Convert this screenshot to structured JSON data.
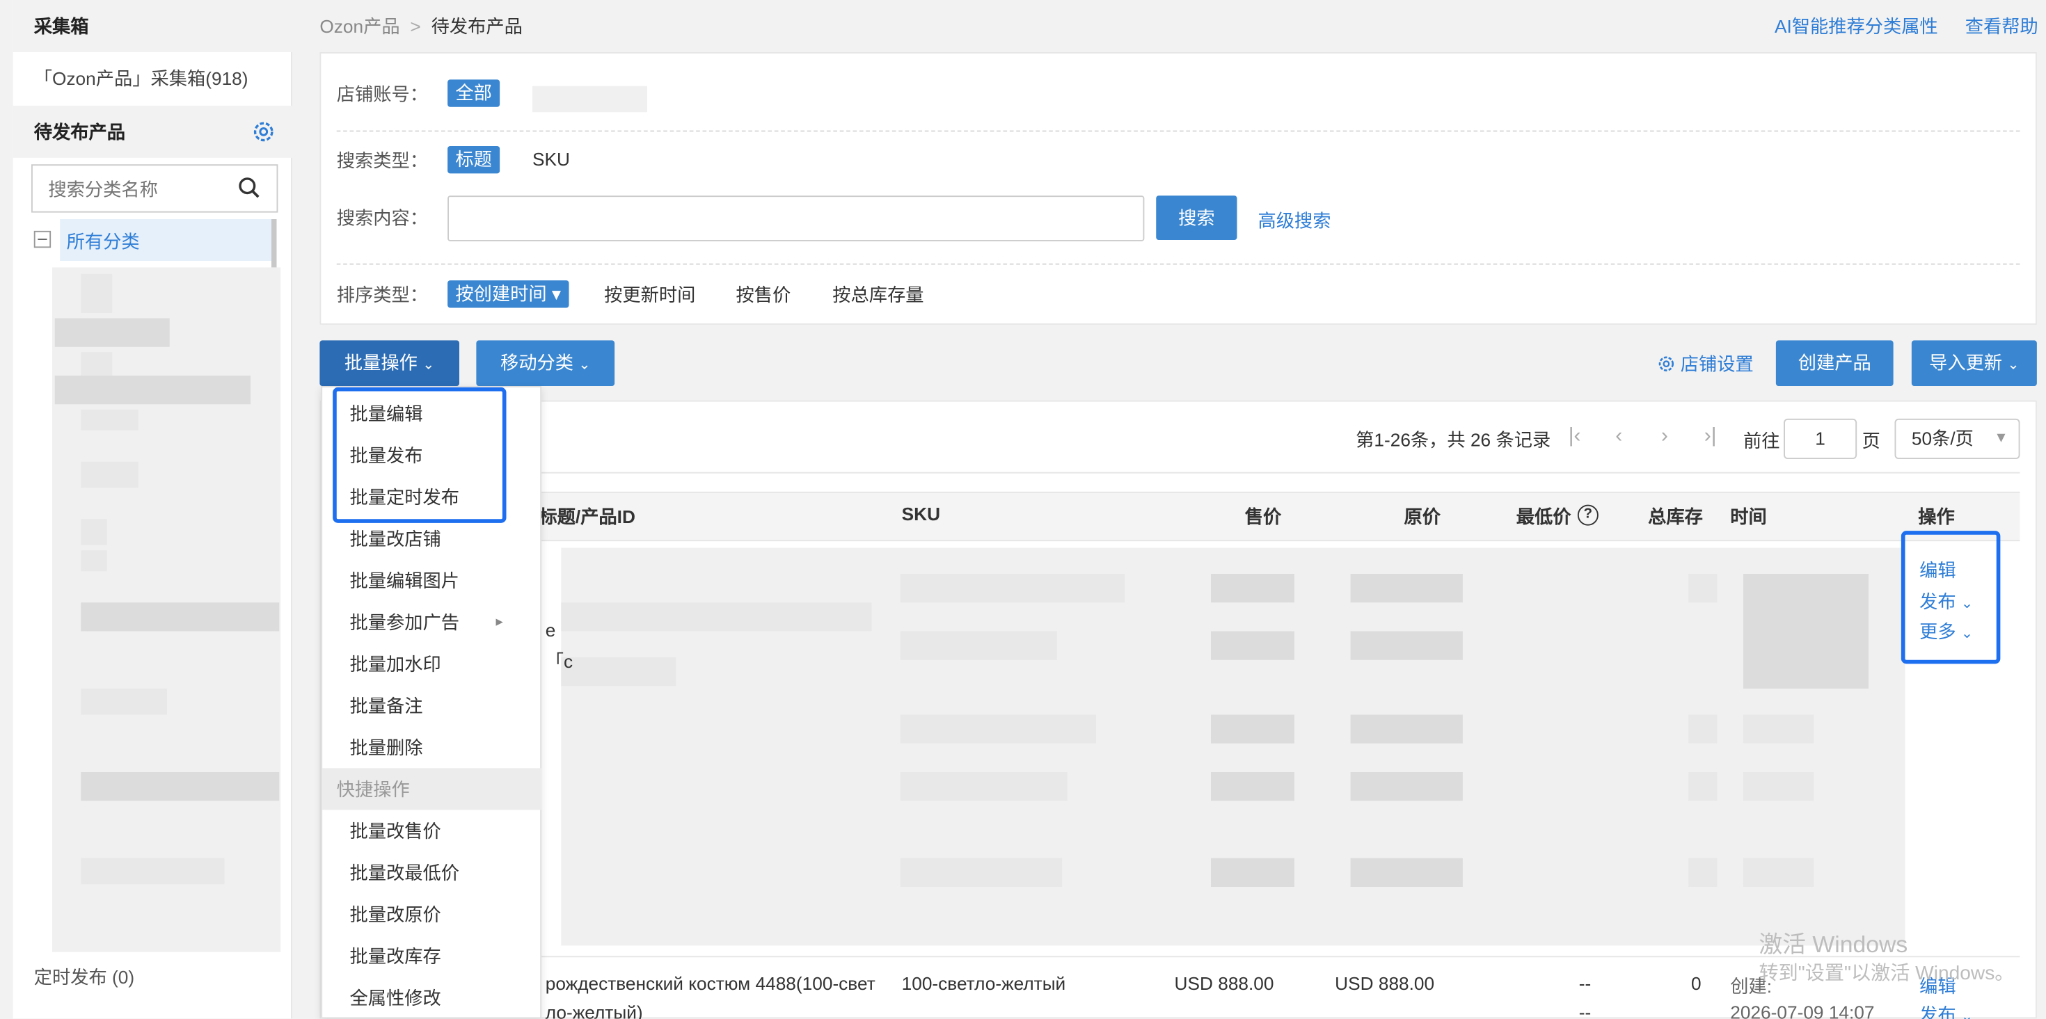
{
  "sidebar": {
    "collect_title": "采集箱",
    "collect_item": "「Ozon产品」采集箱(918)",
    "pending_title": "待发布产品",
    "search_placeholder": "搜索分类名称",
    "all_category": "所有分类",
    "scheduled": "定时发布 (0)"
  },
  "breadcrumb": {
    "root": "Ozon产品",
    "separator": ">",
    "current": "待发布产品"
  },
  "header_links": {
    "ai": "AI智能推荐分类属性",
    "help": "查看帮助"
  },
  "filters": {
    "store_label": "店铺账号：",
    "store_tag": "全部",
    "search_type_label": "搜索类型：",
    "search_type_active": "标题",
    "search_type_other": "SKU",
    "search_content_label": "搜索内容：",
    "search_value": "",
    "search_button": "搜索",
    "advanced_search": "高级搜索",
    "sort_label": "排序类型：",
    "sort_active": "按创建时间 ▾",
    "sort_options": [
      "按更新时间",
      "按售价",
      "按总库存量"
    ]
  },
  "toolbar": {
    "batch_ops": "批量操作",
    "move_category": "移动分类",
    "store_settings": "店铺设置",
    "create_product": "创建产品",
    "import_update": "导入更新"
  },
  "batch_menu": {
    "items": [
      "批量编辑",
      "批量发布",
      "批量定时发布",
      "批量改店铺",
      "批量编辑图片",
      "批量参加广告",
      "批量加水印",
      "批量备注",
      "批量删除"
    ],
    "group_label": "快捷操作",
    "quick_items": [
      "批量改售价",
      "批量改最低价",
      "批量改原价",
      "批量改库存",
      "全属性修改"
    ]
  },
  "pagination": {
    "summary": "第1-26条，共 26 条记录",
    "goto_label": "前往",
    "page_value": "1",
    "page_unit": "页",
    "page_size": "50条/页"
  },
  "table": {
    "columns": [
      "标题/产品ID",
      "SKU",
      "售价",
      "原价",
      "最低价",
      "总库存",
      "时间",
      "操作"
    ],
    "row_actions": [
      "编辑",
      "发布",
      "更多"
    ],
    "partial_title_prefix": "e",
    "partial_title_line2": "「c",
    "bottom_row": {
      "title_line1": "рождественский костюм 4488(100-свет",
      "title_line2": "ло-желтый)",
      "sku": "100-светло-желтый",
      "price": "USD 888.00",
      "original_price": "USD 888.00",
      "min_price": "--",
      "min_price_2": "--",
      "stock": "0",
      "created_label": "创建:",
      "created_time": "2026-07-09 14:07",
      "edit": "编辑",
      "publish": "发布"
    }
  },
  "os_watermark": {
    "line1": "激活 Windows",
    "line2": "转到\"设置\"以激活 Windows。"
  },
  "colors": {
    "accent": "#3a86d0",
    "highlight": "#1e6ff0",
    "link": "#2e7dd6"
  },
  "icons": [
    "gear-icon",
    "search-icon",
    "collapse-icon",
    "chevron-down-icon",
    "chevron-right-icon",
    "help-circle-icon",
    "first-page-icon",
    "prev-page-icon",
    "next-page-icon",
    "last-page-icon"
  ]
}
